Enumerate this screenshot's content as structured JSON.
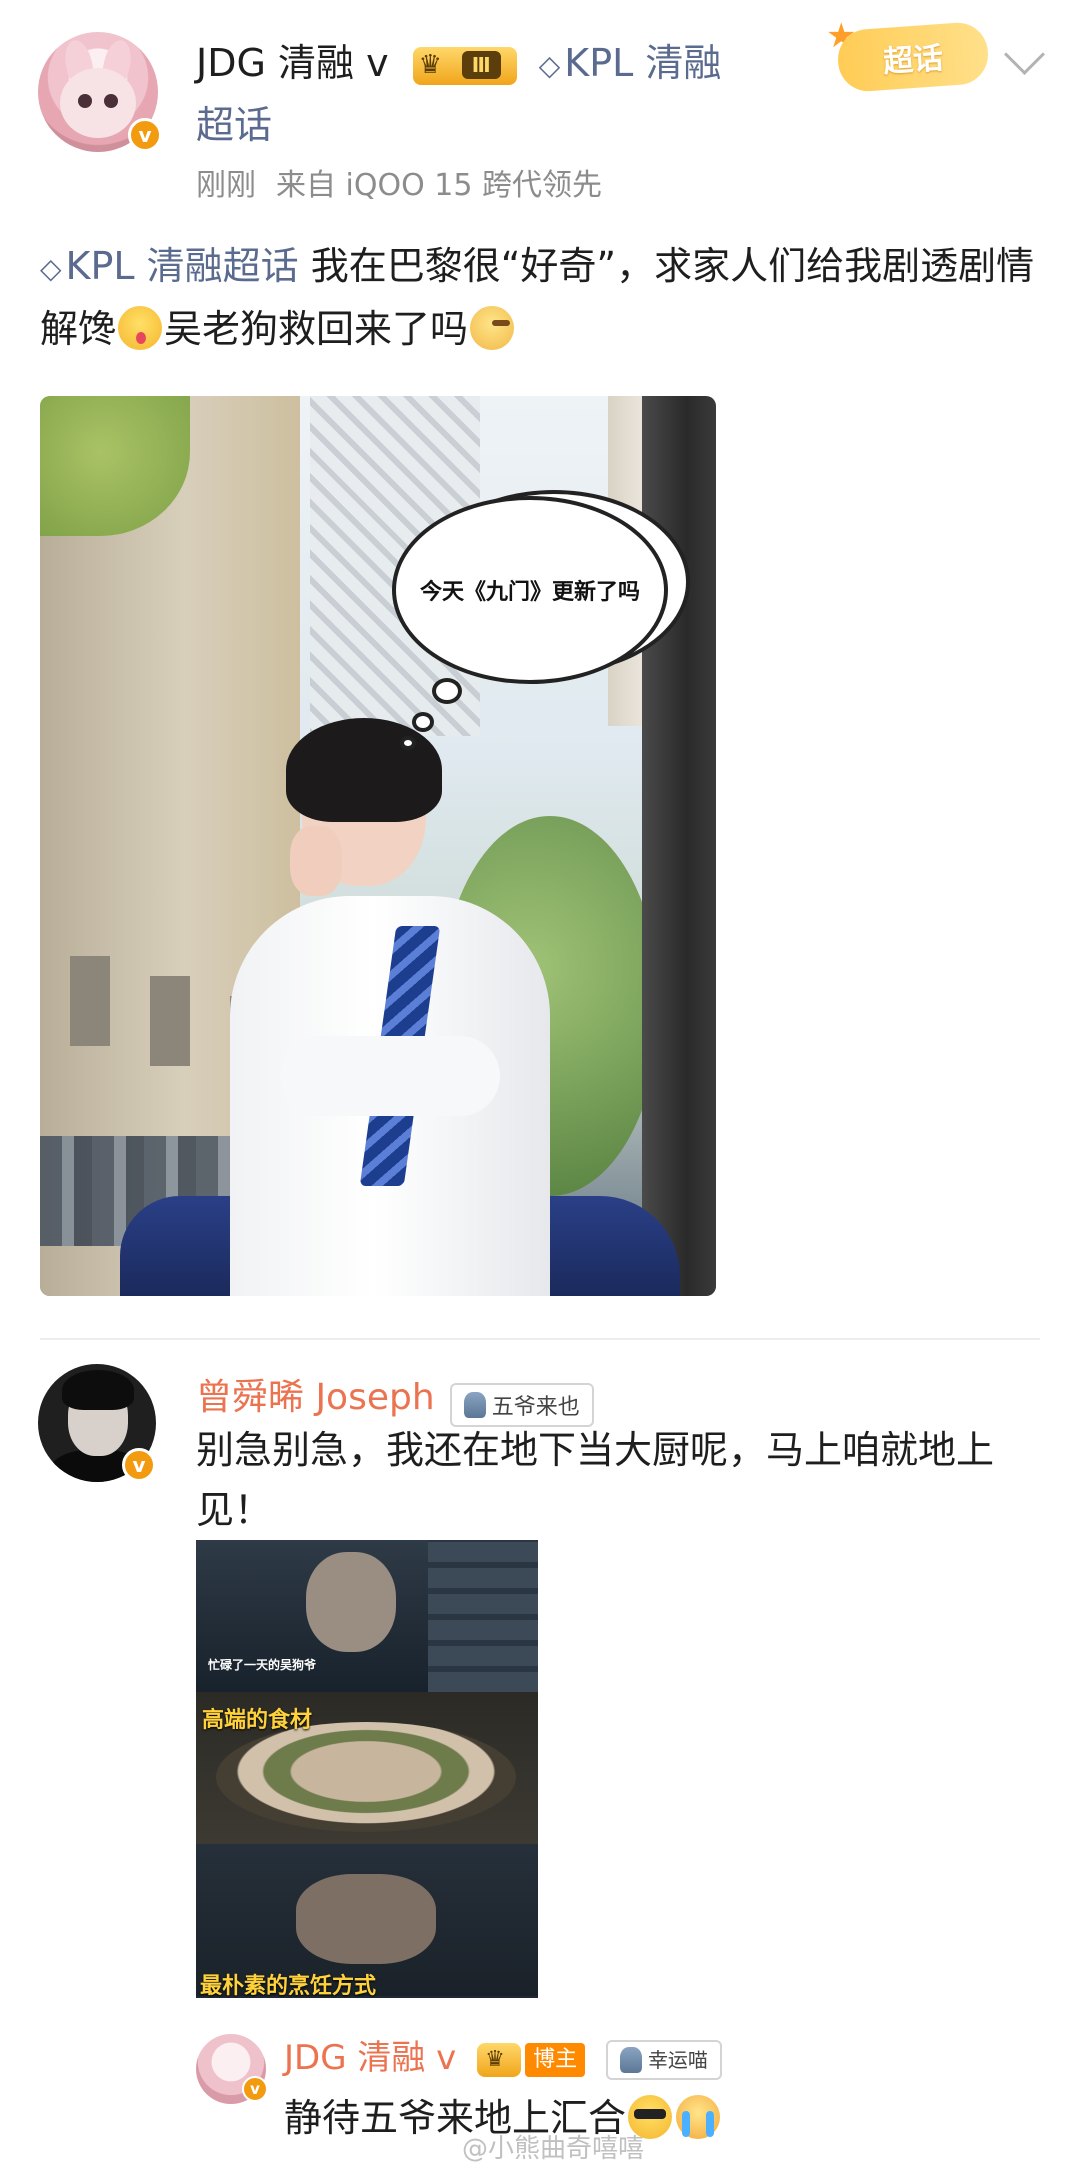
{
  "post": {
    "author": "JDG 清融 v",
    "level": "Ⅲ",
    "topic_name": "KPL 清融",
    "topic_suffix": "超话",
    "time": "刚刚",
    "source": "来自 iQOO 15 跨代领先",
    "chaohua_chip": "超话",
    "body_topic": "KPL 清融超话",
    "body_text_1": " 我在巴黎很“好奇”，求家人们给我剧透剧情解馋",
    "body_text_2": "吴老狗救回来了吗",
    "bubble_text": "今天《九门》更新了吗"
  },
  "comment": {
    "name": "曾舜晞 Joseph",
    "fan_badge": "五爷来也",
    "text": "别急别急，我还在地下当大厨呢，马上咱就地上见！",
    "video_caption_1": "忙碌了一天的吴狗爷",
    "video_caption_2": "高端的食材",
    "video_caption_3": "最朴素的烹饪方式"
  },
  "reply": {
    "name": "JDG 清融 v",
    "blogger_badge": "博主",
    "fan_badge": "幸运喵",
    "text": "静待五爷来地上汇合"
  },
  "watermark": "@小熊曲奇嘻嘻",
  "colors": {
    "topic_link": "#5b6b90",
    "commenter_name": "#eb7350",
    "verified_badge": "#f29b11",
    "meta_gray": "#8c8c8c"
  },
  "icons": [
    "verified-v-icon",
    "level-crown-icon",
    "topic-diamond-icon",
    "chevron-down-icon",
    "fan-cat-icon"
  ]
}
